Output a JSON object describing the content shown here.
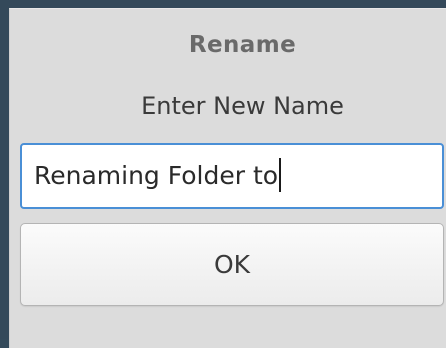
{
  "dialog": {
    "title": "Rename",
    "prompt": "Enter New Name",
    "input_value": "Renaming Folder to",
    "ok_label": "OK"
  },
  "colors": {
    "desktop_background": "#344a5b",
    "dialog_background": "#dcdcdc",
    "input_focus_border": "#4a8fd6"
  }
}
